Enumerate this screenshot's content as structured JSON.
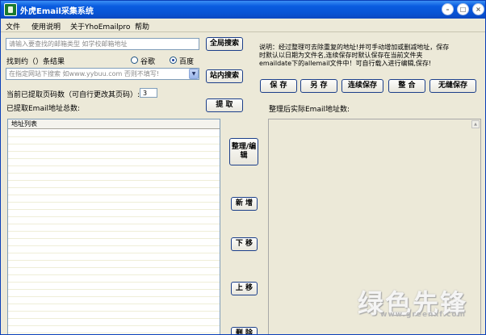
{
  "window": {
    "title": "外虎Email采集系统"
  },
  "titlebar_buttons": {
    "minimize": "–",
    "maximize": "□",
    "close": "×"
  },
  "menu": [
    "文件",
    "使用说明",
    "关于YhoEmailpro",
    "帮助"
  ],
  "search": {
    "placeholder": "请输入要查找的邮箱类型 如学校邮箱地址",
    "global_button": "全局搜索",
    "found_label": "找到约（）条结果",
    "engine_google": "谷歌",
    "engine_baidu": "百度",
    "site_placeholder": "在指定网站下搜索 如www.yybuu.com 否则不填写!",
    "site_button": "站内搜索",
    "dropdown_arrow": "▼"
  },
  "pages": {
    "label": "当前已提取页码数（可自行更改其页码）:",
    "value": "3",
    "email_count_label": "已提取Email地址总数:",
    "extract_button": "提 取"
  },
  "list": {
    "header": "地址列表"
  },
  "side_buttons": {
    "organize": "整理/编辑",
    "add": "新 增",
    "down": "下 移",
    "up": "上 移",
    "bottom": "删 除"
  },
  "note": {
    "line1": "说明：经过整理可去除重复的地址!并可手动增加或删减地址，保存",
    "line2": "时默认以日期为文件名,连续保存时默认保存在当前文件夹",
    "line3": "emaildate下的allemail文件中！可自行载入进行编辑,保存!"
  },
  "save_buttons": [
    "保 存",
    "另 存",
    "连续保存",
    "整 合",
    "无缝保存"
  ],
  "result": {
    "label": "整理后实际Email地址数:",
    "scroll_up": "▲"
  },
  "watermark": {
    "text": "绿色先锋",
    "url": "www.greenxf.com"
  }
}
